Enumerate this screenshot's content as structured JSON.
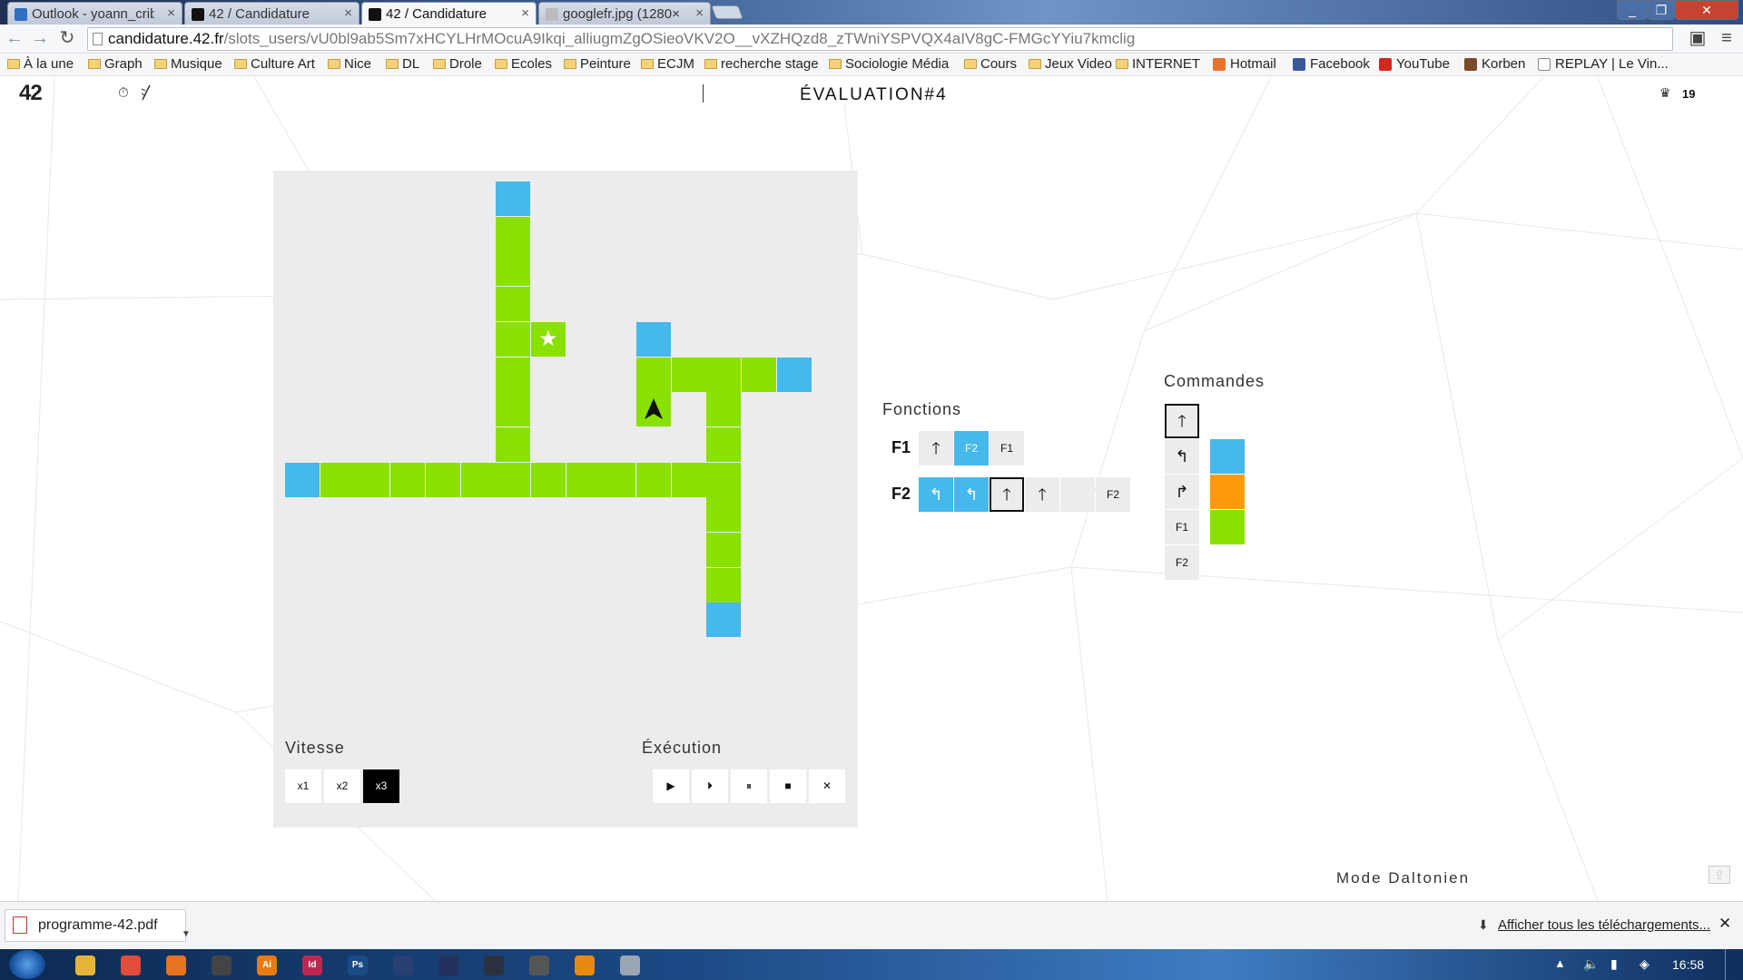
{
  "browser": {
    "tabs": [
      {
        "title": "Outlook - yoann_crib",
        "favicon_color": "#2f6fc4",
        "active": false
      },
      {
        "title": "42 / Candidature",
        "favicon_color": "#111111",
        "active": false
      },
      {
        "title": "42 / Candidature",
        "favicon_color": "#111111",
        "active": true
      },
      {
        "title": "googlefr.jpg (1280×",
        "favicon_color": "#bbbbbb",
        "active": false
      }
    ],
    "url_host": "candidature.42.fr",
    "url_path": "/slots_users/vU0bl9ab5Sm7xHCYLHrMOcuA9Ikqi_alliugmZgOSieoVKV2O__vXZHQzd8_zTWniYSPVQX4aIV8gC-FMGcYYiu7kmclig",
    "bookmarks": [
      {
        "label": "À la une",
        "icon": "folder-icon"
      },
      {
        "label": "Graph",
        "icon": "folder-icon"
      },
      {
        "label": "Musique",
        "icon": "folder-icon"
      },
      {
        "label": "Culture Art",
        "icon": "folder-icon"
      },
      {
        "label": "Nice",
        "icon": "folder-icon"
      },
      {
        "label": "DL",
        "icon": "folder-icon"
      },
      {
        "label": "Drole",
        "icon": "folder-icon"
      },
      {
        "label": "Ecoles",
        "icon": "folder-icon"
      },
      {
        "label": "Peinture",
        "icon": "folder-icon"
      },
      {
        "label": "ECJM",
        "icon": "folder-icon"
      },
      {
        "label": "recherche stage",
        "icon": "folder-icon"
      },
      {
        "label": "Sociologie Média",
        "icon": "folder-icon"
      },
      {
        "label": "Cours",
        "icon": "folder-icon"
      },
      {
        "label": "Jeux Video",
        "icon": "folder-icon"
      },
      {
        "label": "INTERNET",
        "icon": "folder-icon"
      },
      {
        "label": "Hotmail",
        "icon": "hotmail-icon",
        "color": "#e8732c"
      },
      {
        "label": "Facebook",
        "icon": "facebook-icon",
        "color": "#3b5998"
      },
      {
        "label": "YouTube",
        "icon": "youtube-icon",
        "color": "#d3271f"
      },
      {
        "label": "Korben",
        "icon": "korben-icon",
        "color": "#7a4a2a"
      },
      {
        "label": "REPLAY | Le Vin...",
        "icon": "page-icon",
        "color": "#ffffff"
      }
    ]
  },
  "header": {
    "logo": "42",
    "title": "ÉVALUATION#4",
    "score": "19"
  },
  "board": {
    "cells": [
      {
        "c": 6,
        "r": 0,
        "color": "blue"
      },
      {
        "c": 6,
        "r": 1,
        "color": "green"
      },
      {
        "c": 6,
        "r": 2,
        "color": "green"
      },
      {
        "c": 6,
        "r": 3,
        "color": "green"
      },
      {
        "c": 6,
        "r": 4,
        "color": "green"
      },
      {
        "c": 7,
        "r": 4,
        "color": "green",
        "item": "star"
      },
      {
        "c": 10,
        "r": 4,
        "color": "blue"
      },
      {
        "c": 6,
        "r": 5,
        "color": "green"
      },
      {
        "c": 10,
        "r": 5,
        "color": "green"
      },
      {
        "c": 11,
        "r": 5,
        "color": "green"
      },
      {
        "c": 12,
        "r": 5,
        "color": "green"
      },
      {
        "c": 13,
        "r": 5,
        "color": "green"
      },
      {
        "c": 14,
        "r": 5,
        "color": "blue"
      },
      {
        "c": 6,
        "r": 6,
        "color": "green"
      },
      {
        "c": 10,
        "r": 6,
        "color": "green",
        "item": "robot"
      },
      {
        "c": 12,
        "r": 6,
        "color": "green"
      },
      {
        "c": 6,
        "r": 7,
        "color": "green"
      },
      {
        "c": 12,
        "r": 7,
        "color": "green"
      },
      {
        "c": 0,
        "r": 8,
        "color": "blue"
      },
      {
        "c": 1,
        "r": 8,
        "color": "green"
      },
      {
        "c": 2,
        "r": 8,
        "color": "green"
      },
      {
        "c": 3,
        "r": 8,
        "color": "green"
      },
      {
        "c": 4,
        "r": 8,
        "color": "green"
      },
      {
        "c": 5,
        "r": 8,
        "color": "green"
      },
      {
        "c": 6,
        "r": 8,
        "color": "green"
      },
      {
        "c": 7,
        "r": 8,
        "color": "green"
      },
      {
        "c": 8,
        "r": 8,
        "color": "green"
      },
      {
        "c": 9,
        "r": 8,
        "color": "green"
      },
      {
        "c": 10,
        "r": 8,
        "color": "green"
      },
      {
        "c": 11,
        "r": 8,
        "color": "green"
      },
      {
        "c": 12,
        "r": 8,
        "color": "green"
      },
      {
        "c": 12,
        "r": 9,
        "color": "green"
      },
      {
        "c": 12,
        "r": 10,
        "color": "green"
      },
      {
        "c": 12,
        "r": 11,
        "color": "green"
      },
      {
        "c": 12,
        "r": 12,
        "color": "blue"
      }
    ],
    "robot_heading": "up"
  },
  "vitesse": {
    "label": "Vitesse",
    "options": [
      "x1",
      "x2",
      "x3"
    ],
    "selected": "x3"
  },
  "execution": {
    "label": "Éxécution",
    "buttons": [
      {
        "name": "play-icon",
        "glyph": "▶"
      },
      {
        "name": "step-icon",
        "glyph": "⏵"
      },
      {
        "name": "pause-icon",
        "glyph": "⏸"
      },
      {
        "name": "stop-icon",
        "glyph": "■"
      },
      {
        "name": "clear-icon",
        "glyph": "✕"
      }
    ]
  },
  "fonctions": {
    "label": "Fonctions",
    "rows": [
      {
        "name": "F1",
        "slots": [
          {
            "glyph": "🡑",
            "icon": "arrow-up-icon",
            "color": "none"
          },
          {
            "glyph": "F2",
            "icon": "call-f2",
            "color": "blue"
          },
          {
            "glyph": "F1",
            "icon": "call-f1",
            "color": "none"
          }
        ]
      },
      {
        "name": "F2",
        "slots": [
          {
            "glyph": "↰",
            "icon": "turn-left-icon",
            "color": "blue"
          },
          {
            "glyph": "↰",
            "icon": "turn-left-icon",
            "color": "blue"
          },
          {
            "glyph": "🡑",
            "icon": "arrow-up-icon",
            "color": "none",
            "selected": true
          },
          {
            "glyph": "🡑",
            "icon": "arrow-up-icon",
            "color": "none"
          },
          {
            "glyph": "",
            "icon": "empty-slot",
            "color": "none"
          },
          {
            "glyph": "F2",
            "icon": "call-f2",
            "color": "none"
          }
        ]
      }
    ]
  },
  "commandes": {
    "label": "Commandes",
    "actions": [
      {
        "glyph": "🡑",
        "icon": "arrow-up-icon",
        "selected": true
      },
      {
        "glyph": "↰",
        "icon": "turn-left-icon"
      },
      {
        "glyph": "↱",
        "icon": "turn-right-icon"
      },
      {
        "glyph": "F1",
        "icon": "call-f1"
      },
      {
        "glyph": "F2",
        "icon": "call-f2"
      }
    ],
    "colors": [
      "#45b8ec",
      "#ff9a0c",
      "#8ae000"
    ]
  },
  "footer": {
    "daltonien": "Mode Daltonien"
  },
  "downloads": {
    "file": "programme-42.pdf",
    "show_all": "Afficher tous les téléchargements..."
  },
  "taskbar": {
    "clock": "16:58",
    "apps": [
      {
        "name": "explorer-icon",
        "color": "#e5b53a",
        "glyph": ""
      },
      {
        "name": "chrome-icon",
        "color": "#e34b3a",
        "glyph": ""
      },
      {
        "name": "firefox-icon",
        "color": "#e8731c",
        "glyph": ""
      },
      {
        "name": "app-icon",
        "color": "#444444",
        "glyph": ""
      },
      {
        "name": "illustrator-icon",
        "color": "#e87b12",
        "glyph": "Ai"
      },
      {
        "name": "indesign-icon",
        "color": "#c0264f",
        "glyph": "Id"
      },
      {
        "name": "photoshop-icon",
        "color": "#1a4b86",
        "glyph": "Ps"
      },
      {
        "name": "app-icon",
        "color": "#2a3f73",
        "glyph": ""
      },
      {
        "name": "app-icon",
        "color": "#22325c",
        "glyph": ""
      },
      {
        "name": "unity-icon",
        "color": "#2c3140",
        "glyph": ""
      },
      {
        "name": "app-icon",
        "color": "#555555",
        "glyph": ""
      },
      {
        "name": "vlc-icon",
        "color": "#e88a12",
        "glyph": ""
      },
      {
        "name": "app-icon",
        "color": "#9aa6b6",
        "glyph": ""
      }
    ]
  }
}
